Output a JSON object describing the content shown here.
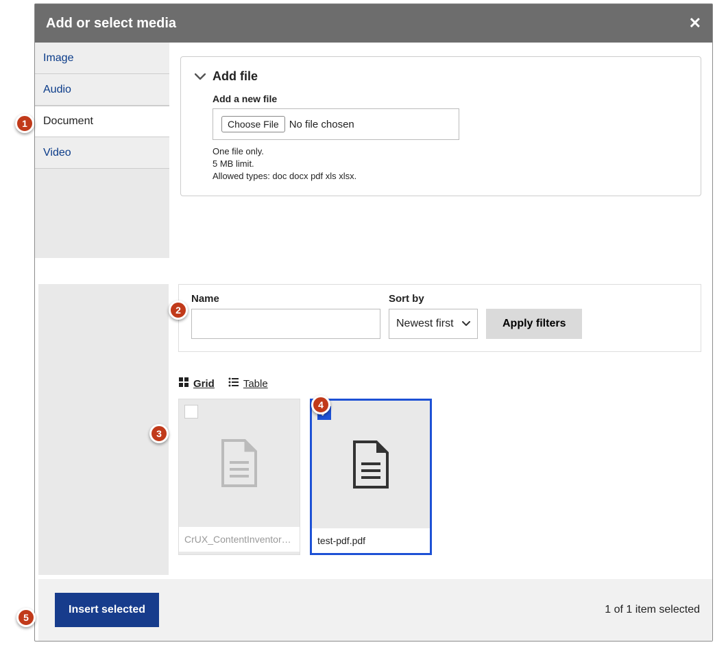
{
  "header": {
    "title": "Add or select media"
  },
  "tabs": {
    "image": "Image",
    "audio": "Audio",
    "document": "Document",
    "video": "Video"
  },
  "add_file": {
    "section_title": "Add file",
    "field_label": "Add a new file",
    "choose_btn": "Choose File",
    "no_file": "No file chosen",
    "constraint1": "One file only.",
    "constraint2": "5 MB limit.",
    "constraint3": "Allowed types: doc docx pdf xls xlsx."
  },
  "filters": {
    "name_label": "Name",
    "sort_label": "Sort by",
    "sort_value": "Newest first",
    "apply": "Apply filters"
  },
  "views": {
    "grid": "Grid",
    "table": "Table"
  },
  "items": {
    "a": "CrUX_ContentInventor…",
    "b": "test-pdf.pdf"
  },
  "footer": {
    "insert": "Insert selected",
    "count": "1 of 1 item selected"
  },
  "badges": {
    "b1": "1",
    "b2": "2",
    "b3": "3",
    "b4": "4",
    "b5": "5"
  }
}
